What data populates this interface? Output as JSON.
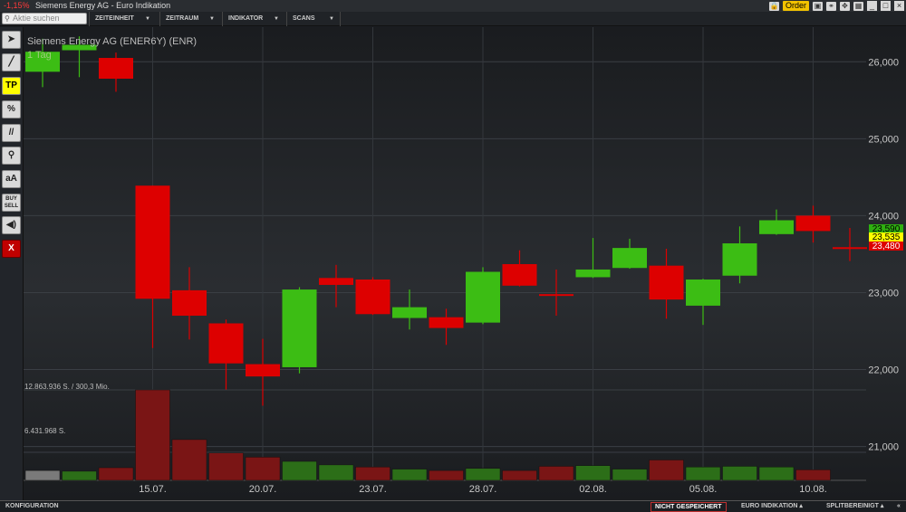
{
  "titlebar": {
    "change": "-1,15%",
    "title": "Siemens Energy AG - Euro Indikation",
    "order_label": "Order"
  },
  "menubar": {
    "search_placeholder": "Aktie suchen",
    "items": [
      {
        "label": "ZEITEINHEIT"
      },
      {
        "label": "ZEITRAUM"
      },
      {
        "label": "INDIKATOR"
      },
      {
        "label": "SCANS"
      }
    ]
  },
  "toolbar": {
    "tools": [
      "pointer",
      "line",
      "TP",
      "%",
      "//",
      "zoom",
      "aA",
      "BUY SELL",
      "sound",
      "X"
    ]
  },
  "chart_data": {
    "type": "candlestick",
    "instrument": "Siemens Energy AG (ENER6Y) (ENR)",
    "period": "1 Tag",
    "y_ticks": [
      "26,000",
      "25,000",
      "24,000",
      "23,000",
      "22,000",
      "21,000"
    ],
    "ylim": [
      20.56,
      26.45
    ],
    "x_labels": [
      {
        "index": 3,
        "label": "15.07."
      },
      {
        "index": 6,
        "label": "20.07."
      },
      {
        "index": 9,
        "label": "23.07."
      },
      {
        "index": 12,
        "label": "28.07."
      },
      {
        "index": 15,
        "label": "02.08."
      },
      {
        "index": 18,
        "label": "05.08."
      },
      {
        "index": 21,
        "label": "10.08."
      }
    ],
    "colors": {
      "up": "#3cbd14",
      "down": "#dd0000",
      "flat": "#dd0000"
    },
    "candles": [
      {
        "o": 25.87,
        "h": 26.3,
        "l": 25.67,
        "c": 26.13
      },
      {
        "o": 26.15,
        "h": 26.33,
        "l": 25.8,
        "c": 26.22
      },
      {
        "o": 26.05,
        "h": 26.12,
        "l": 25.61,
        "c": 25.78
      },
      {
        "o": 24.39,
        "h": 24.39,
        "l": 22.28,
        "c": 22.92
      },
      {
        "o": 23.03,
        "h": 23.33,
        "l": 22.39,
        "c": 22.7
      },
      {
        "o": 22.6,
        "h": 22.65,
        "l": 21.74,
        "c": 22.08
      },
      {
        "o": 22.07,
        "h": 22.4,
        "l": 21.53,
        "c": 21.91
      },
      {
        "o": 22.03,
        "h": 23.07,
        "l": 21.95,
        "c": 23.04
      },
      {
        "o": 23.19,
        "h": 23.36,
        "l": 22.81,
        "c": 23.1
      },
      {
        "o": 23.17,
        "h": 23.2,
        "l": 22.71,
        "c": 22.72
      },
      {
        "o": 22.67,
        "h": 23.04,
        "l": 22.52,
        "c": 22.81
      },
      {
        "o": 22.68,
        "h": 22.79,
        "l": 22.32,
        "c": 22.54
      },
      {
        "o": 22.61,
        "h": 23.33,
        "l": 22.59,
        "c": 23.27
      },
      {
        "o": 23.37,
        "h": 23.55,
        "l": 23.08,
        "c": 23.09
      },
      {
        "o": 22.98,
        "h": 23.3,
        "l": 22.7,
        "c": 22.96
      },
      {
        "o": 23.2,
        "h": 23.71,
        "l": 23.19,
        "c": 23.3
      },
      {
        "o": 23.32,
        "h": 23.7,
        "l": 23.31,
        "c": 23.58
      },
      {
        "o": 23.35,
        "h": 23.57,
        "l": 22.66,
        "c": 22.91
      },
      {
        "o": 22.83,
        "h": 23.18,
        "l": 22.58,
        "c": 23.17
      },
      {
        "o": 23.22,
        "h": 23.86,
        "l": 23.12,
        "c": 23.64
      },
      {
        "o": 23.76,
        "h": 24.08,
        "l": 23.75,
        "c": 23.94
      },
      {
        "o": 24.0,
        "h": 24.13,
        "l": 23.65,
        "c": 23.8
      },
      {
        "o": 23.59,
        "h": 23.84,
        "l": 23.41,
        "c": 23.58
      }
    ],
    "price_labels": [
      {
        "value": 23.59,
        "text": "23,590",
        "bg": "#2fb010",
        "fg": "#000"
      },
      {
        "value": 23.535,
        "text": "23,535",
        "bg": "#ffff00",
        "fg": "#000"
      },
      {
        "value": 23.48,
        "text": "23,480",
        "bg": "#dd0000",
        "fg": "#fff"
      }
    ],
    "volume": {
      "max_label": "12.863.936 S. / 300,3 Mio.",
      "mid_label": "6.431.968 S.",
      "max": 12863936,
      "values": [
        1400000,
        1300000,
        1800000,
        12863936,
        5800000,
        3900000,
        3300000,
        2700000,
        2200000,
        1900000,
        1600000,
        1400000,
        1700000,
        1400000,
        2000000,
        2100000,
        1600000,
        2900000,
        1900000,
        2000000,
        1900000,
        1500000,
        0
      ],
      "colors": [
        "#7a7a7a",
        "#2c6e18",
        "#7a1515",
        "#7a1515",
        "#7a1515",
        "#7a1515",
        "#7a1515",
        "#2c6e18",
        "#2c6e18",
        "#7a1515",
        "#2c6e18",
        "#7a1515",
        "#2c6e18",
        "#7a1515",
        "#7a1515",
        "#2c6e18",
        "#2c6e18",
        "#7a1515",
        "#2c6e18",
        "#2c6e18",
        "#2c6e18",
        "#7a1515",
        "#7a1515"
      ]
    }
  },
  "statusbar": {
    "config": "KONFIGURATION",
    "unsaved": "NICHT GESPEICHERT",
    "euro": "EURO INDIKATION ▴",
    "split": "SPLITBEREINIGT ▴",
    "close": "«"
  }
}
